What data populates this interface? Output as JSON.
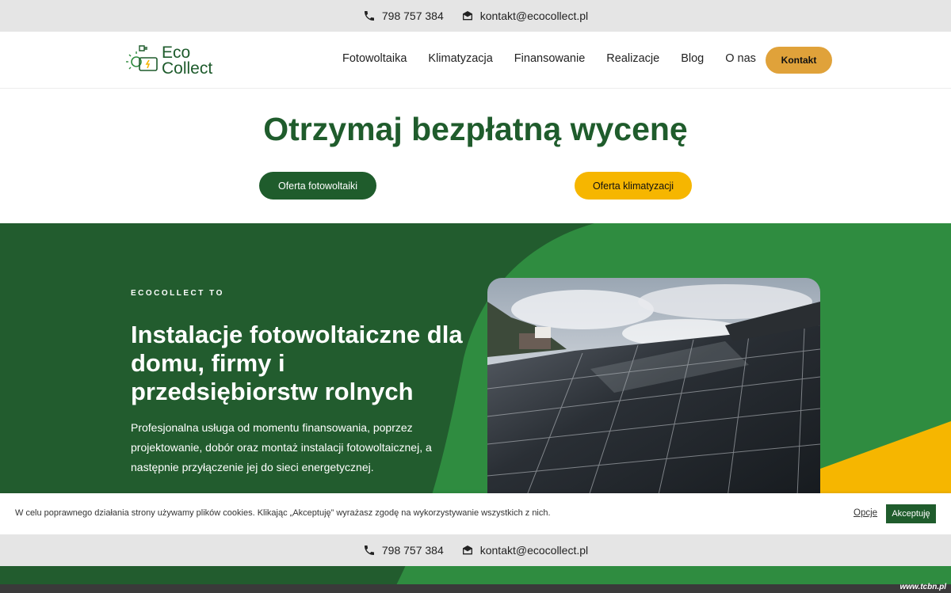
{
  "topbar": {
    "phone": "798 757 384",
    "email": "kontakt@ecocollect.pl"
  },
  "header": {
    "logo_line1": "Eco",
    "logo_line2": "Collect",
    "nav": [
      "Fotowoltaika",
      "Klimatyzacja",
      "Finansowanie",
      "Realizacje",
      "Blog",
      "O nas"
    ],
    "contact_button": "Kontakt"
  },
  "quote": {
    "title": "Otrzymaj bezpłatną wycenę",
    "pv_button": "Oferta fotowoltaiki",
    "ac_button": "Oferta klimatyzacji"
  },
  "hero": {
    "eyebrow": "ECOCOLLECT TO",
    "title": "Instalacje fotowoltaiczne dla domu, firmy i przedsiębiorstw rolnych",
    "text": "Profesjonalna usługa od momentu finansowania, poprzez projektowanie, dobór oraz montaż instalacji fotowoltaicznej, a następnie przyłączenie jej do sieci energetycznej."
  },
  "cookie": {
    "text": "W celu poprawnego działania strony używamy plików cookies. Klikając „Akceptuję” wyrażasz zgodę na wykorzystywanie wszystkich z nich.",
    "options": "Opcje",
    "accept": "Akceptuję"
  },
  "bottombar": {
    "phone": "798 757 384",
    "email": "kontakt@ecocollect.pl"
  },
  "watermark": "www.tcbn.pl",
  "colors": {
    "brand_green": "#1f5c2c",
    "accent_green": "#2e8b3e",
    "yellow": "#f6b600",
    "orange": "#e0a23a"
  }
}
